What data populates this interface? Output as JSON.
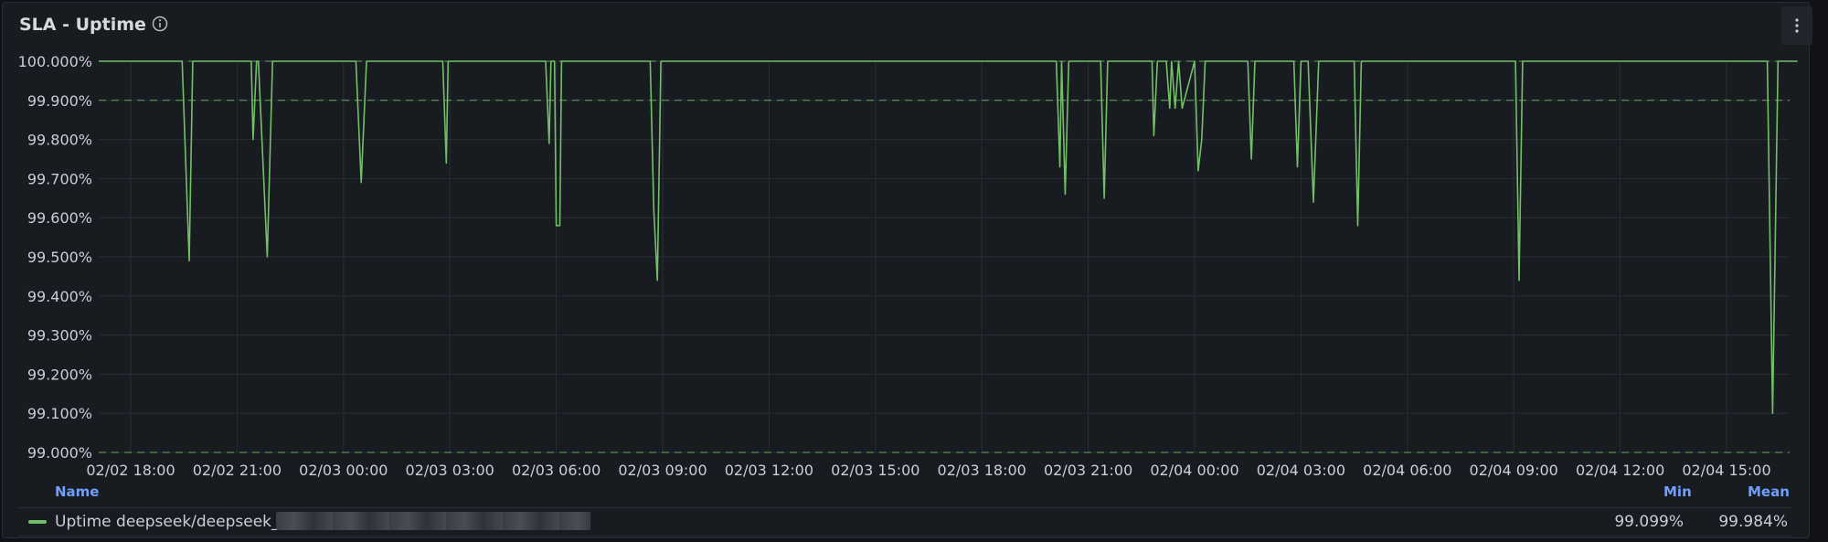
{
  "panel": {
    "title": "SLA - Uptime",
    "info_icon": "info-circle-icon",
    "menu_icon": "vertical-ellipsis-icon"
  },
  "colors": {
    "series": "#73bf69",
    "threshold": "#73bf69",
    "grid": "#2a2d35",
    "axis_text": "#ccccdc",
    "legend_header": "#6e9fff"
  },
  "legend": {
    "header_name": "Name",
    "header_min": "Min",
    "header_mean": "Mean",
    "series_name": "Uptime deepseek/deepseek_v3",
    "min": "99.099%",
    "mean": "99.984%"
  },
  "chart_data": {
    "type": "line",
    "x_unit": "hours elapsed from 02/02 18:00",
    "xlim": [
      -0.9,
      47.0
    ],
    "ylim": [
      99.0,
      100.0
    ],
    "y_ticks": [
      "99.000%",
      "99.100%",
      "99.200%",
      "99.300%",
      "99.400%",
      "99.500%",
      "99.600%",
      "99.700%",
      "99.800%",
      "99.900%",
      "100.000%"
    ],
    "x_ticks": [
      {
        "h": 0,
        "label": "02/02 18:00"
      },
      {
        "h": 3,
        "label": "02/02 21:00"
      },
      {
        "h": 6,
        "label": "02/03 00:00"
      },
      {
        "h": 9,
        "label": "02/03 03:00"
      },
      {
        "h": 12,
        "label": "02/03 06:00"
      },
      {
        "h": 15,
        "label": "02/03 09:00"
      },
      {
        "h": 18,
        "label": "02/03 12:00"
      },
      {
        "h": 21,
        "label": "02/03 15:00"
      },
      {
        "h": 24,
        "label": "02/03 18:00"
      },
      {
        "h": 27,
        "label": "02/03 21:00"
      },
      {
        "h": 30,
        "label": "02/04 00:00"
      },
      {
        "h": 33,
        "label": "02/04 03:00"
      },
      {
        "h": 36,
        "label": "02/04 06:00"
      },
      {
        "h": 39,
        "label": "02/04 09:00"
      },
      {
        "h": 42,
        "label": "02/04 12:00"
      },
      {
        "h": 45,
        "label": "02/04 15:00"
      }
    ],
    "thresholds": [
      100.0,
      99.9,
      99.0
    ],
    "grid": true,
    "legend_placement": "bottom",
    "series": [
      {
        "name": "Uptime deepseek/deepseek_v3",
        "x": [
          -0.9,
          1.45,
          1.65,
          1.75,
          3.4,
          3.45,
          3.55,
          3.6,
          3.85,
          4.0,
          4.1,
          6.35,
          6.5,
          6.65,
          8.8,
          8.9,
          8.95,
          11.7,
          11.8,
          11.85,
          11.95,
          12.0,
          12.1,
          12.15,
          12.2,
          12.3,
          14.65,
          14.75,
          14.85,
          14.95,
          15.05,
          26.1,
          26.2,
          26.25,
          26.35,
          26.45,
          26.55,
          27.35,
          27.45,
          27.55,
          28.8,
          28.85,
          28.95,
          29.2,
          29.3,
          29.35,
          29.45,
          29.55,
          29.65,
          30.0,
          30.1,
          30.2,
          30.3,
          31.5,
          31.6,
          31.7,
          32.8,
          32.9,
          33.0,
          33.2,
          33.35,
          33.5,
          34.5,
          34.6,
          34.7,
          39.05,
          39.15,
          39.25,
          46.15,
          46.3,
          46.45,
          47.0
        ],
        "y": [
          100.0,
          100.0,
          99.49,
          100.0,
          100.0,
          99.8,
          100.0,
          100.0,
          99.5,
          100.0,
          100.0,
          100.0,
          99.69,
          100.0,
          100.0,
          99.74,
          100.0,
          100.0,
          99.79,
          100.0,
          100.0,
          99.58,
          99.58,
          100.0,
          100.0,
          100.0,
          100.0,
          99.62,
          99.44,
          100.0,
          100.0,
          100.0,
          99.73,
          100.0,
          99.66,
          100.0,
          100.0,
          100.0,
          99.65,
          100.0,
          100.0,
          99.81,
          100.0,
          100.0,
          99.88,
          100.0,
          99.88,
          100.0,
          99.88,
          100.0,
          99.72,
          99.8,
          100.0,
          100.0,
          99.75,
          100.0,
          100.0,
          99.73,
          100.0,
          100.0,
          99.64,
          100.0,
          100.0,
          99.58,
          100.0,
          100.0,
          99.44,
          100.0,
          100.0,
          99.1,
          100.0,
          100.0
        ]
      }
    ]
  }
}
